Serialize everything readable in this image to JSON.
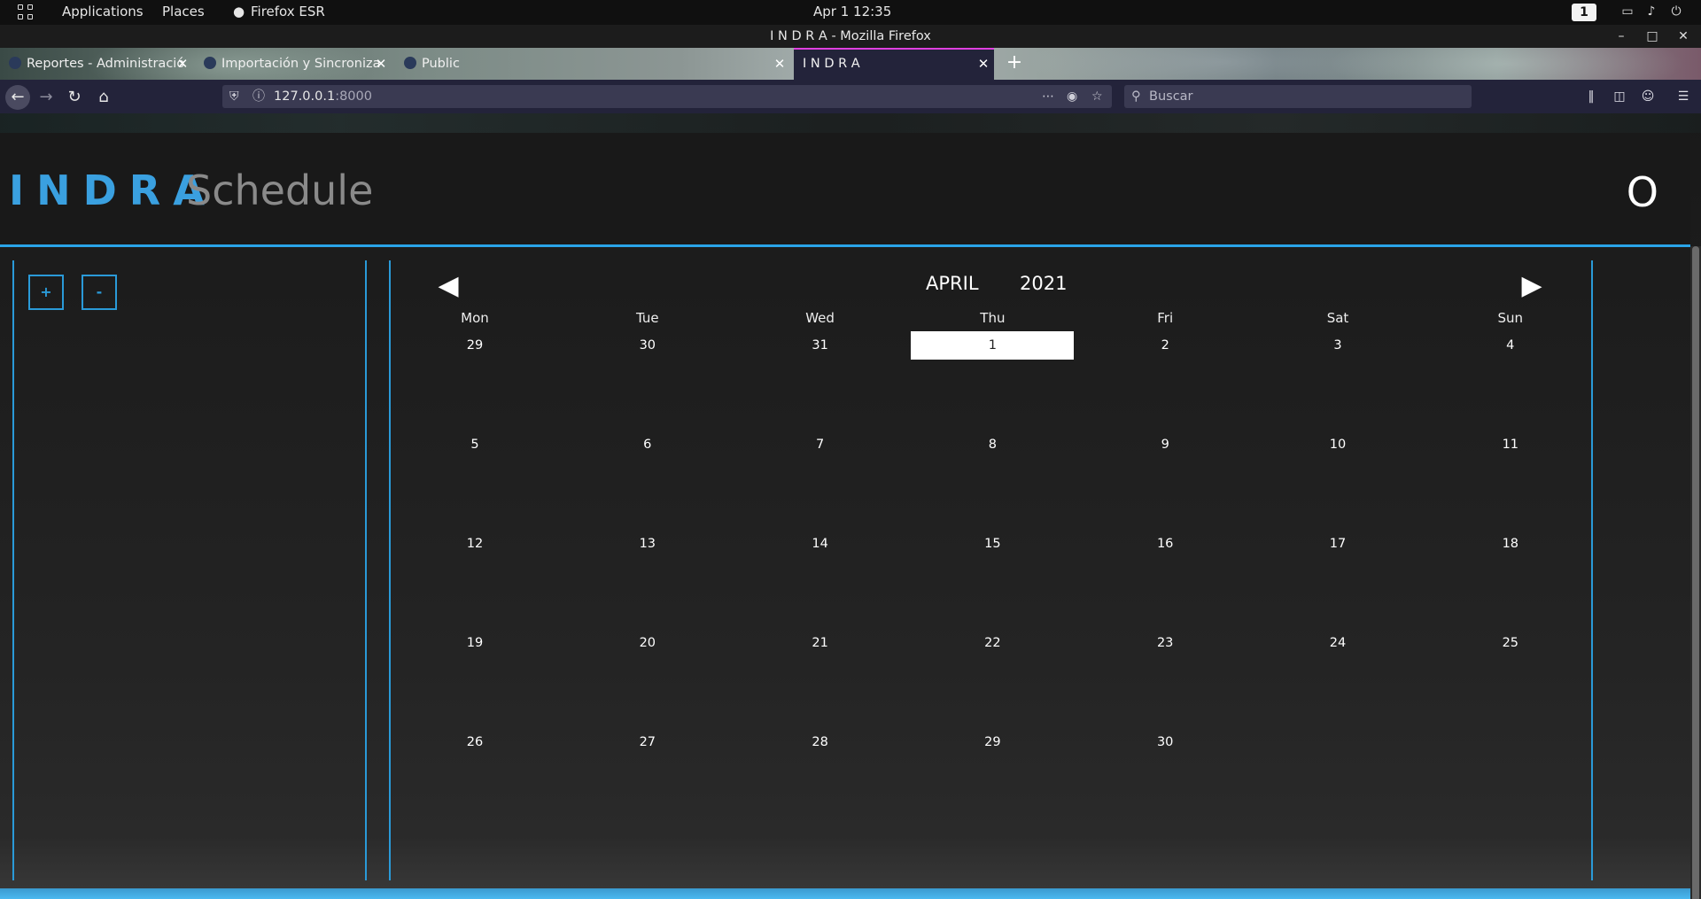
{
  "topbar": {
    "applications": "Applications",
    "places": "Places",
    "browser": "Firefox ESR",
    "clock": "Apr 1  12:35",
    "workspace": "1"
  },
  "window": {
    "title": "I N D R A - Mozilla Firefox"
  },
  "tabs": [
    {
      "label": "Reportes - Administració"
    },
    {
      "label": "Importación y Sincroniza"
    },
    {
      "label": "Public"
    },
    {
      "label": "I N D R A"
    }
  ],
  "navbar": {
    "url_host": "127.0.0.1",
    "url_port": ":8000",
    "search_placeholder": "Buscar"
  },
  "app": {
    "logo": "INDRA",
    "title": "Schedule",
    "header_icon_text": "O",
    "add_label": "+",
    "remove_label": "-"
  },
  "calendar": {
    "month": "APRIL",
    "year": "2021",
    "weekdays": [
      "Mon",
      "Tue",
      "Wed",
      "Thu",
      "Fri",
      "Sat",
      "Sun"
    ],
    "weeks": [
      [
        "29",
        "30",
        "31",
        "1",
        "2",
        "3",
        "4"
      ],
      [
        "5",
        "6",
        "7",
        "8",
        "9",
        "10",
        "11"
      ],
      [
        "12",
        "13",
        "14",
        "15",
        "16",
        "17",
        "18"
      ],
      [
        "19",
        "20",
        "21",
        "22",
        "23",
        "24",
        "25"
      ],
      [
        "26",
        "27",
        "28",
        "29",
        "30",
        "",
        ""
      ]
    ],
    "today": "1",
    "accent_color": "#2aa4e8"
  }
}
